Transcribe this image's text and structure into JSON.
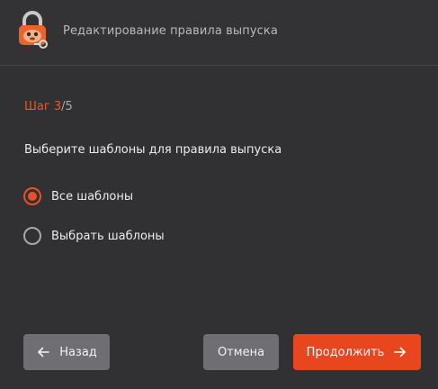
{
  "window": {
    "title": "Редактирование правила выпуска",
    "app_icon": "lock-mascot-icon"
  },
  "step": {
    "prefix": "Шаг",
    "current": "3",
    "separator": "/",
    "total": "5"
  },
  "question": "Выберите шаблоны для правила выпуска",
  "options": [
    {
      "label": "Все шаблоны",
      "checked": true
    },
    {
      "label": "Выбрать шаблоны",
      "checked": false
    }
  ],
  "buttons": {
    "back_label": "Назад",
    "cancel_label": "Отмена",
    "next_label": "Продолжить"
  },
  "colors": {
    "accent": "#e8461f",
    "background": "#313133",
    "secondary_button": "#6f6f73"
  }
}
